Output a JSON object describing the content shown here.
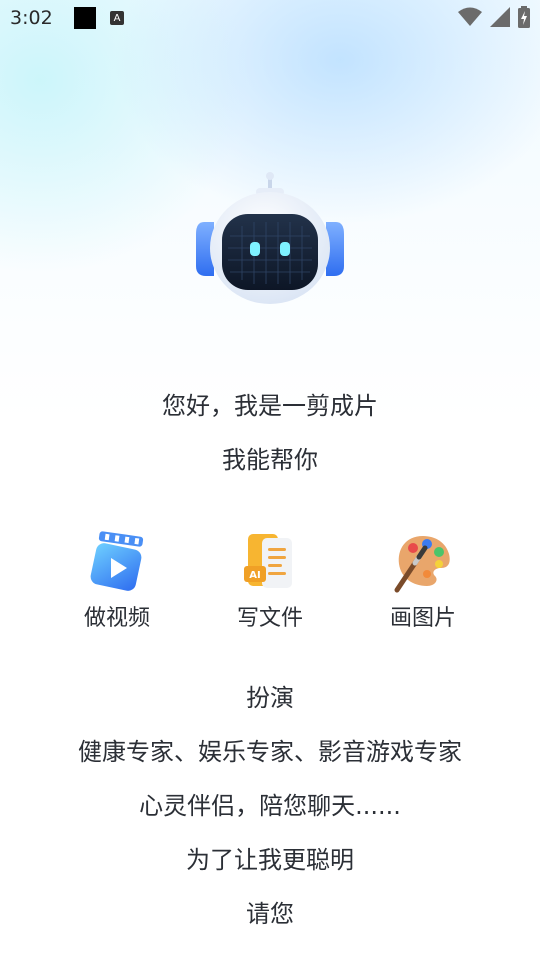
{
  "status_bar": {
    "time": "3:02",
    "icons": [
      "black-square-icon",
      "a-notification-icon",
      "wifi-icon",
      "signal-icon",
      "battery-charging-icon"
    ]
  },
  "hero": {
    "greeting": "您好，我是一剪成片",
    "subtitle": "我能帮你"
  },
  "features": [
    {
      "label": "做视频",
      "icon": "video-clapper-icon"
    },
    {
      "label": "写文件",
      "icon": "ai-document-icon"
    },
    {
      "label": "画图片",
      "icon": "paint-palette-icon"
    }
  ],
  "roles": {
    "title": "扮演",
    "line1": "健康专家、娱乐专家、影音游戏专家",
    "line2": "心灵伴侣，陪您聊天......",
    "line3": "为了让我更聪明",
    "line4": "请您"
  },
  "colors": {
    "accent_blue": "#3e7cf5",
    "text": "#2b2f36"
  }
}
